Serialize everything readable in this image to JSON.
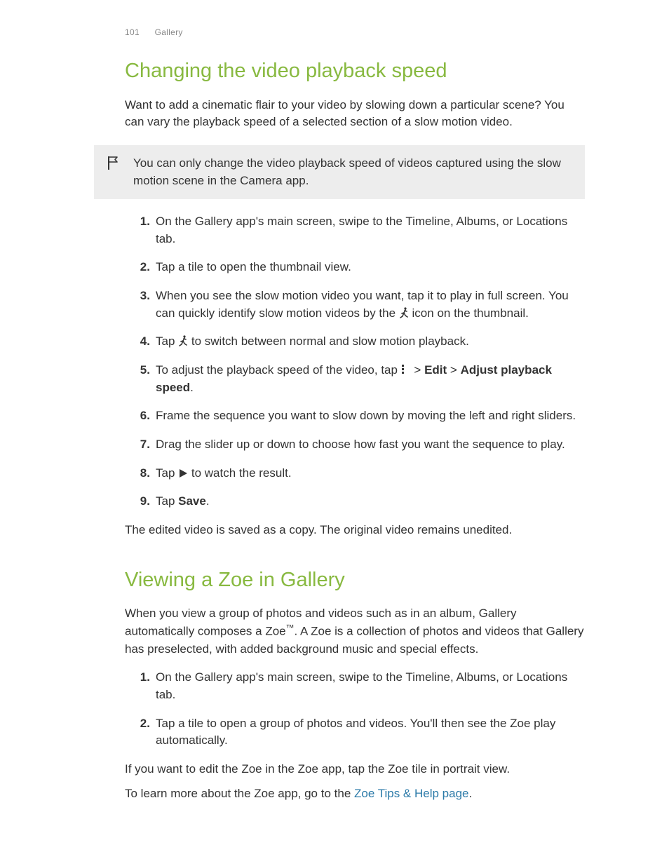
{
  "header": {
    "page_number": "101",
    "section_name": "Gallery"
  },
  "section1": {
    "title": "Changing the video playback speed",
    "intro": "Want to add a cinematic flair to your video by slowing down a particular scene? You can vary the playback speed of a selected section of a slow motion video.",
    "note": "You can only change the video playback speed of videos captured using the slow motion scene in the Camera app.",
    "steps": {
      "s1": "On the Gallery app's main screen, swipe to the Timeline, Albums, or Locations tab.",
      "s2": "Tap a tile to open the thumbnail view.",
      "s3a": "When you see the slow motion video you want, tap it to play in full screen. You can quickly identify slow motion videos by the ",
      "s3b": " icon on the thumbnail.",
      "s4a": "Tap ",
      "s4b": " to switch between normal and slow motion playback.",
      "s5a": "To adjust the playback speed of the video, tap ",
      "s5b": " > ",
      "s5c": "Edit",
      "s5d": " > ",
      "s5e": "Adjust playback speed",
      "s5f": ".",
      "s6": "Frame the sequence you want to slow down by moving the left and right sliders.",
      "s7": "Drag the slider up or down to choose how fast you want the sequence to play.",
      "s8a": "Tap ",
      "s8b": " to watch the result.",
      "s9a": "Tap ",
      "s9b": "Save",
      "s9c": "."
    },
    "outro": "The edited video is saved as a copy. The original video remains unedited."
  },
  "section2": {
    "title": "Viewing a Zoe in Gallery",
    "intro_a": "When you view a group of photos and videos such as in an album, Gallery automatically composes a Zoe",
    "intro_tm": "™",
    "intro_b": ". A Zoe is a collection of photos and videos that Gallery has preselected, with added background music and special effects.",
    "steps": {
      "s1": "On the Gallery app's main screen, swipe to the Timeline, Albums, or Locations tab.",
      "s2": "Tap a tile to open a group of photos and videos. You'll then see the Zoe play automatically."
    },
    "outro1": "If you want to edit the Zoe in the Zoe app, tap the Zoe tile in portrait view.",
    "outro2a": "To learn more about the Zoe app, go to the ",
    "outro2_link": "Zoe Tips & Help page",
    "outro2b": "."
  }
}
